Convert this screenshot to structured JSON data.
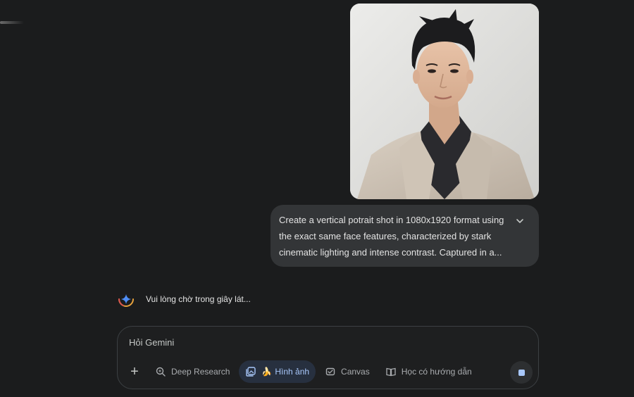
{
  "conversation": {
    "uploaded_image": {
      "alt": "Portrait photo of a young man in a beige blazer"
    },
    "prompt": {
      "lines": [
        "Create a vertical potrait shot in 1080x1920 format using",
        "the exact same face features, characterized by stark",
        "cinematic lighting and intense contrast. Captured in a..."
      ]
    },
    "status": {
      "text": "Vui lòng chờ trong giây lát..."
    }
  },
  "input": {
    "placeholder": "Hỏi Gemini"
  },
  "tools": {
    "add_label": "+",
    "deep_research": "Deep Research",
    "image_banana": "🍌",
    "image": "Hình ảnh",
    "canvas": "Canvas",
    "guided_learning": "Học có hướng dẫn"
  },
  "colors": {
    "background": "#1b1c1d",
    "bubble": "#333537",
    "accent": "#a8c7fa",
    "active_chip": "#27303f"
  },
  "icons": {
    "expand": "chevron-down-icon",
    "status": "gemini-spark-icon",
    "deep_research": "deep-research-icon",
    "image": "image-gallery-icon",
    "canvas": "canvas-icon",
    "guided_learning": "book-icon",
    "stop": "stop-icon"
  }
}
